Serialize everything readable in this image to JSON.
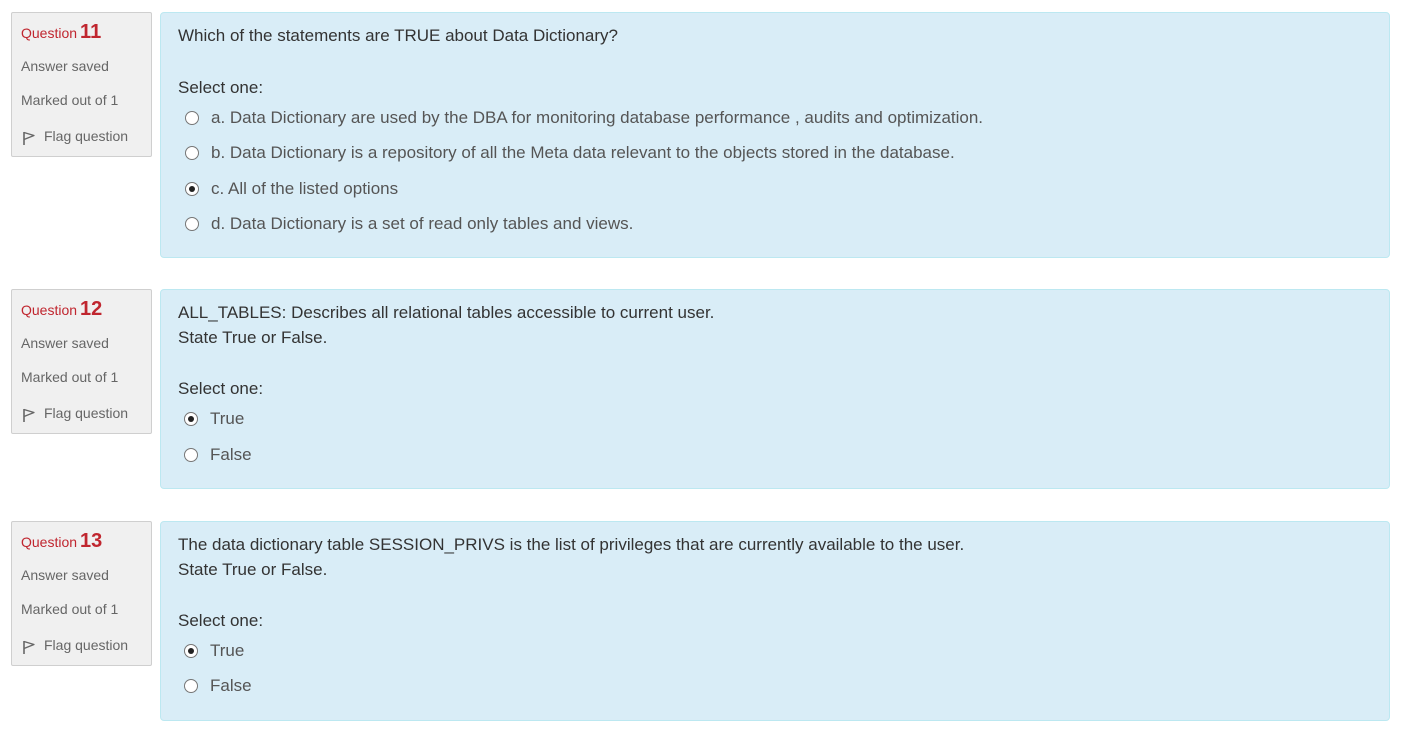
{
  "labels": {
    "question_word": "Question",
    "select_one": "Select one:"
  },
  "questions": [
    {
      "number": "11",
      "state": "Answer saved",
      "grade": "Marked out of 1",
      "flag_label": "Flag question",
      "text_lines": [
        "Which of the statements are TRUE about Data Dictionary?"
      ],
      "options": [
        {
          "label": "a. Data Dictionary are used by the DBA for monitoring database performance , audits and optimization.",
          "checked": false
        },
        {
          "label": "b. Data Dictionary is a repository of all the Meta data relevant to the objects stored in the database.",
          "checked": false
        },
        {
          "label": "c. All of the listed options",
          "checked": true
        },
        {
          "label": "d. Data Dictionary is a set of read only tables and views.",
          "checked": false
        }
      ]
    },
    {
      "number": "12",
      "state": "Answer saved",
      "grade": "Marked out of 1",
      "flag_label": "Flag question",
      "text_lines": [
        "ALL_TABLES: Describes all relational tables accessible to current user.",
        "State True or False."
      ],
      "options": [
        {
          "label": "True",
          "checked": true
        },
        {
          "label": "False",
          "checked": false
        }
      ]
    },
    {
      "number": "13",
      "state": "Answer saved",
      "grade": "Marked out of 1",
      "flag_label": "Flag question",
      "text_lines": [
        "The data dictionary table SESSION_PRIVS is the list of privileges that are currently available to the user.",
        "State True or False."
      ],
      "options": [
        {
          "label": "True",
          "checked": true
        },
        {
          "label": "False",
          "checked": false
        }
      ]
    }
  ]
}
